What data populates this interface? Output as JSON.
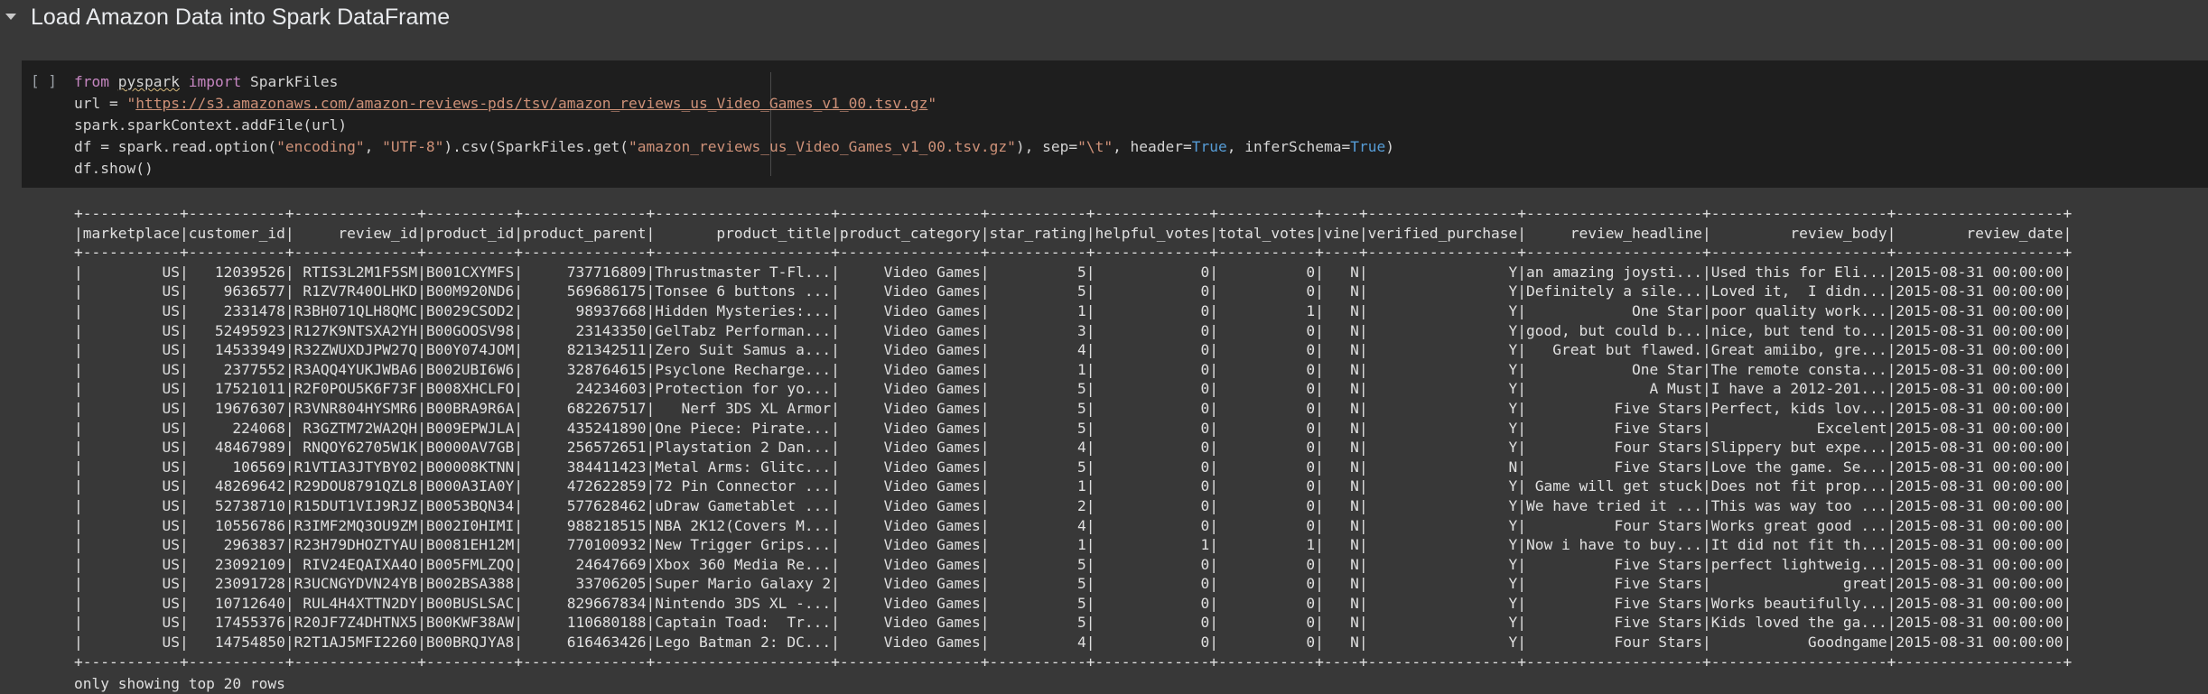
{
  "section": {
    "title": "Load Amazon Data into Spark DataFrame",
    "toggle_icon": "caret-down-icon"
  },
  "cell": {
    "run_indicator": "[ ]",
    "code": {
      "line1": {
        "kw_from": "from",
        "module": "pyspark",
        "kw_import": "import",
        "name": "SparkFiles"
      },
      "line2": {
        "prefix": "url = ",
        "quote_open": "\"",
        "url": "https://s3.amazonaws.com/amazon-reviews-pds/tsv/amazon_reviews_us_Video_Games_v1_00.tsv.gz",
        "quote_close": "\""
      },
      "line3": "spark.sparkContext.addFile(url)",
      "line4": {
        "p1": "df = spark.read.option(",
        "s1": "\"encoding\"",
        "p2": ", ",
        "s2": "\"UTF-8\"",
        "p3": ").csv(SparkFiles.get(",
        "s3": "\"amazon_reviews_us_Video_Games_v1_00.tsv.gz\"",
        "p4": "), sep=",
        "s4": "\"\\t\"",
        "p5": ", header=",
        "b1": "True",
        "p6": ", inferSchema=",
        "b2": "True",
        "p7": ")"
      },
      "line5": "df.show()"
    }
  },
  "output": {
    "rows": [
      "+-----------+-----------+--------------+----------+--------------+--------------------+----------------+-----------+-------------+-----------+----+-----------------+--------------------+--------------------+-------------------+",
      "|marketplace|customer_id|     review_id|product_id|product_parent|       product_title|product_category|star_rating|helpful_votes|total_votes|vine|verified_purchase|     review_headline|         review_body|        review_date|",
      "+-----------+-----------+--------------+----------+--------------+--------------------+----------------+-----------+-------------+-----------+----+-----------------+--------------------+--------------------+-------------------+",
      "|         US|   12039526| RTIS3L2M1F5SM|B001CXYMFS|     737716809|Thrustmaster T-Fl...|     Video Games|          5|            0|          0|   N|                Y|an amazing joysti...|Used this for Eli...|2015-08-31 00:00:00|",
      "|         US|    9636577| R1ZV7R40OLHKD|B00M920ND6|     569686175|Tonsee 6 buttons ...|     Video Games|          5|            0|          0|   N|                Y|Definitely a sile...|Loved it,  I didn...|2015-08-31 00:00:00|",
      "|         US|    2331478|R3BH071QLH8QMC|B0029CSOD2|      98937668|Hidden Mysteries:...|     Video Games|          1|            0|          1|   N|                Y|            One Star|poor quality work...|2015-08-31 00:00:00|",
      "|         US|   52495923|R127K9NTSXA2YH|B00GOOSV98|      23143350|GelTabz Performan...|     Video Games|          3|            0|          0|   N|                Y|good, but could b...|nice, but tend to...|2015-08-31 00:00:00|",
      "|         US|   14533949|R32ZWUXDJPW27Q|B00Y074JOM|     821342511|Zero Suit Samus a...|     Video Games|          4|            0|          0|   N|                Y|   Great but flawed.|Great amiibo, gre...|2015-08-31 00:00:00|",
      "|         US|    2377552|R3AQQ4YUKJWBA6|B002UBI6W6|     328764615|Psyclone Recharge...|     Video Games|          1|            0|          0|   N|                Y|            One Star|The remote consta...|2015-08-31 00:00:00|",
      "|         US|   17521011|R2F0POU5K6F73F|B008XHCLFO|      24234603|Protection for yo...|     Video Games|          5|            0|          0|   N|                Y|              A Must|I have a 2012-201...|2015-08-31 00:00:00|",
      "|         US|   19676307|R3VNR804HYSMR6|B00BRA9R6A|     682267517|   Nerf 3DS XL Armor|     Video Games|          5|            0|          0|   N|                Y|          Five Stars|Perfect, kids lov...|2015-08-31 00:00:00|",
      "|         US|     224068| R3GZTM72WA2QH|B009EPWJLA|     435241890|One Piece: Pirate...|     Video Games|          5|            0|          0|   N|                Y|          Five Stars|            Excelent|2015-08-31 00:00:00|",
      "|         US|   48467989| RNQOY62705W1K|B0000AV7GB|     256572651|Playstation 2 Dan...|     Video Games|          4|            0|          0|   N|                Y|          Four Stars|Slippery but expe...|2015-08-31 00:00:00|",
      "|         US|     106569|R1VTIA3JTYBY02|B00008KTNN|     384411423|Metal Arms: Glitc...|     Video Games|          5|            0|          0|   N|                N|          Five Stars|Love the game. Se...|2015-08-31 00:00:00|",
      "|         US|   48269642|R29DOU8791QZL8|B000A3IA0Y|     472622859|72 Pin Connector ...|     Video Games|          1|            0|          0|   N|                Y| Game will get stuck|Does not fit prop...|2015-08-31 00:00:00|",
      "|         US|   52738710|R15DUT1VIJ9RJZ|B0053BQN34|     577628462|uDraw Gametablet ...|     Video Games|          2|            0|          0|   N|                Y|We have tried it ...|This was way too ...|2015-08-31 00:00:00|",
      "|         US|   10556786|R3IMF2MQ3OU9ZM|B002I0HIMI|     988218515|NBA 2K12(Covers M...|     Video Games|          4|            0|          0|   N|                Y|          Four Stars|Works great good ...|2015-08-31 00:00:00|",
      "|         US|    2963837|R23H79DHOZTYAU|B0081EH12M|     770100932|New Trigger Grips...|     Video Games|          1|            1|          1|   N|                Y|Now i have to buy...|It did not fit th...|2015-08-31 00:00:00|",
      "|         US|   23092109| RIV24EQAIXA4O|B005FMLZQQ|      24647669|Xbox 360 Media Re...|     Video Games|          5|            0|          0|   N|                Y|          Five Stars|perfect lightweig...|2015-08-31 00:00:00|",
      "|         US|   23091728|R3UCNGYDVN24YB|B002BSA388|      33706205|Super Mario Galaxy 2|     Video Games|          5|            0|          0|   N|                Y|          Five Stars|               great|2015-08-31 00:00:00|",
      "|         US|   10712640| RUL4H4XTTN2DY|B00BUSLSAC|     829667834|Nintendo 3DS XL -...|     Video Games|          5|            0|          0|   N|                Y|          Five Stars|Works beautifully...|2015-08-31 00:00:00|",
      "|         US|   17455376|R20JF7Z4DHTNX5|B00KWF38AW|     110680188|Captain Toad:  Tr...|     Video Games|          5|            0|          0|   N|                Y|          Five Stars|Kids loved the ga...|2015-08-31 00:00:00|",
      "|         US|   14754850|R2T1AJ5MFI2260|B00BRQJYA8|     616463426|Lego Batman 2: DC...|     Video Games|          4|            0|          0|   N|                Y|          Four Stars|           Goodngame|2015-08-31 00:00:00|",
      "+-----------+-----------+--------------+----------+--------------+--------------------+----------------+-----------+-------------+-----------+----+-----------------+--------------------+--------------------+-------------------+"
    ],
    "footer": "only showing top 20 rows"
  }
}
